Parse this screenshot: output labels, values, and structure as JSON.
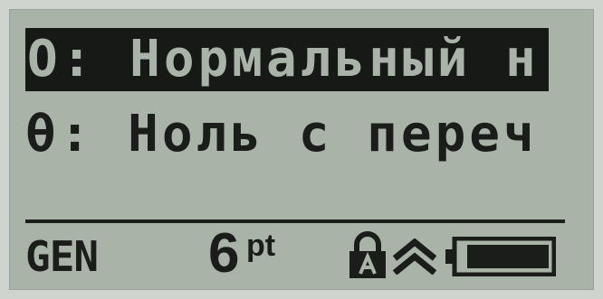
{
  "menu": {
    "items": [
      {
        "label": "O: Нормальный н",
        "selected": true
      },
      {
        "label": "θ: Ноль с переч",
        "selected": false
      }
    ]
  },
  "status_bar": {
    "mode": "GEN",
    "font_size_value": "6",
    "font_size_unit": "pt",
    "icons": [
      "lock-icon",
      "double-chevron-up-icon",
      "battery-icon"
    ],
    "battery_level": 1.0
  },
  "colors": {
    "lcd_background": "#a9b3a8",
    "lcd_foreground": "#1a1d1a",
    "bezel": "#cfd4cf"
  }
}
